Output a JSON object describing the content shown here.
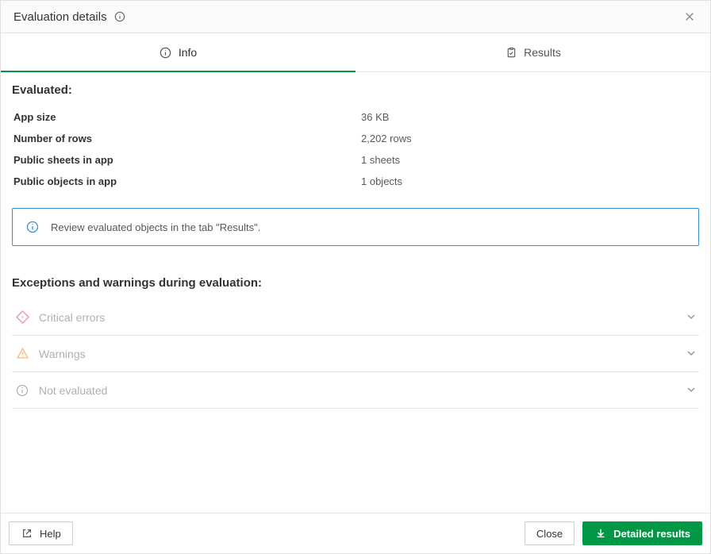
{
  "header": {
    "title": "Evaluation details"
  },
  "tabs": {
    "info": {
      "label": "Info",
      "active": true
    },
    "results": {
      "label": "Results",
      "active": false
    }
  },
  "evaluated": {
    "title": "Evaluated:",
    "rows": [
      {
        "label": "App size",
        "value": "36 KB"
      },
      {
        "label": "Number of rows",
        "value": "2,202 rows"
      },
      {
        "label": "Public sheets in app",
        "value": "1 sheets"
      },
      {
        "label": "Public objects in app",
        "value": "1 objects"
      }
    ]
  },
  "info_banner": {
    "text": "Review evaluated objects in the tab \"Results\"."
  },
  "exceptions": {
    "title": "Exceptions and warnings during evaluation:",
    "items": [
      {
        "label": "Critical errors",
        "icon": "diamond-error",
        "color": "#e8a0a9"
      },
      {
        "label": "Warnings",
        "icon": "triangle-warning",
        "color": "#f2c28b"
      },
      {
        "label": "Not evaluated",
        "icon": "info",
        "color": "#b0b0b0"
      }
    ]
  },
  "footer": {
    "help": "Help",
    "close": "Close",
    "detailed": "Detailed results"
  }
}
